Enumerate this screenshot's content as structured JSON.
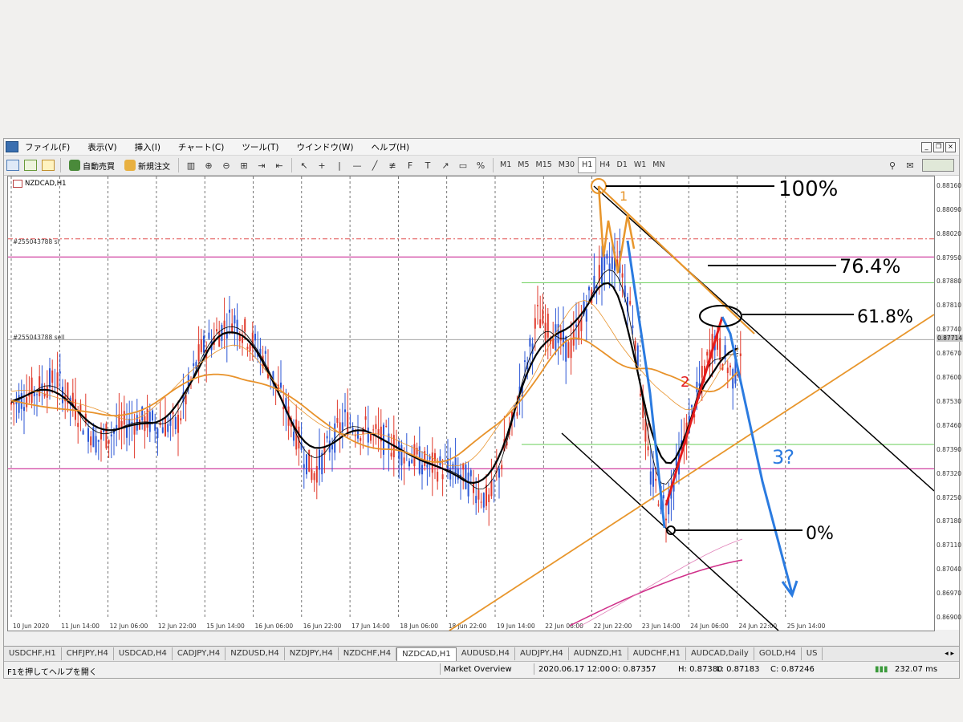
{
  "menu": [
    "ファイル(F)",
    "表示(V)",
    "挿入(I)",
    "チャート(C)",
    "ツール(T)",
    "ウインドウ(W)",
    "ヘルプ(H)"
  ],
  "toolbar": {
    "auto_trade": "自動売買",
    "new_order": "新規注文",
    "timeframes": [
      "M1",
      "M5",
      "M15",
      "M30",
      "H1",
      "H4",
      "D1",
      "W1",
      "MN"
    ],
    "active_timeframe": "H1"
  },
  "chart": {
    "title": "NZDCAD,H1",
    "order_sl_label": "#255043788 sl",
    "order_sell_label": "#255043788 sell",
    "current_price": "0.87714",
    "price_ticks": [
      "0.88160",
      "0.88090",
      "0.88020",
      "0.87950",
      "0.87880",
      "0.87810",
      "0.87740",
      "0.87670",
      "0.87600",
      "0.87530",
      "0.87460",
      "0.87390",
      "0.87320",
      "0.87250",
      "0.87180",
      "0.87110",
      "0.87040",
      "0.86970",
      "0.86900"
    ],
    "time_ticks": [
      "10 Jun 2020",
      "11 Jun 14:00",
      "12 Jun 06:00",
      "12 Jun 22:00",
      "15 Jun 14:00",
      "16 Jun 06:00",
      "16 Jun 22:00",
      "17 Jun 14:00",
      "18 Jun 06:00",
      "18 Jun 22:00",
      "19 Jun 14:00",
      "22 Jun 06:00",
      "22 Jun 22:00",
      "23 Jun 14:00",
      "24 Jun 06:00",
      "24 Jun 22:00",
      "25 Jun 14:00"
    ],
    "annotations": {
      "fib_100": "100%",
      "fib_764": "76.4%",
      "fib_618": "61.8%",
      "fib_0": "0%",
      "wave_1": "1",
      "wave_2": "2",
      "wave_3": "3?"
    }
  },
  "tabs": [
    "USDCHF,H1",
    "CHFJPY,H4",
    "USDCAD,H4",
    "CADJPY,H4",
    "NZDUSD,H4",
    "NZDJPY,H4",
    "NZDCHF,H4",
    "NZDCAD,H1",
    "AUDUSD,H4",
    "AUDJPY,H4",
    "AUDNZD,H1",
    "AUDCHF,H1",
    "AUDCAD,Daily",
    "GOLD,H4",
    "US"
  ],
  "active_tab": "NZDCAD,H1",
  "status": {
    "help": "F1を押してヘルプを開く",
    "profile": "Market Overview",
    "datetime": "2020.06.17 12:00",
    "open": "O: 0.87357",
    "high": "H: 0.87380",
    "low": "L: 0.87183",
    "close": "C: 0.87246",
    "ping": "232.07 ms"
  },
  "colors": {
    "bull": "#e03a2c",
    "bear": "#2c57d6",
    "ma_black": "#000000",
    "ma_orange": "#e8922a",
    "trendline_orange": "#e8962c",
    "hline_magenta": "#d040a0",
    "hline_green": "#7ad46a",
    "annot_blue": "#2b7be0",
    "annot_red": "#e41b1b"
  }
}
